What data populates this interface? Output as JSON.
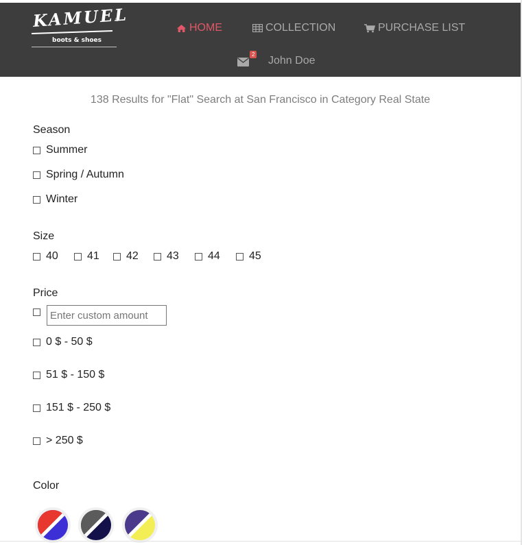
{
  "brand": {
    "name": "KAMUEL",
    "tagline": "boots & shoes",
    "reg": "®"
  },
  "nav": {
    "home": "HOME",
    "collection": "COLLECTION",
    "purchase_list": "PURCHASE LIST",
    "mail_count": "2",
    "user": "John Doe",
    "active": "home",
    "icons": {
      "home": "home-icon",
      "collection": "table-icon",
      "purchase": "cart-icon",
      "mail": "envelope-icon"
    }
  },
  "results_text": "138 Results for \"Flat\" Search at San Francisco in Category Real State",
  "filters": {
    "season": {
      "title": "Season",
      "options": [
        "Summer",
        "Spring / Autumn",
        "Winter"
      ]
    },
    "size": {
      "title": "Size",
      "options": [
        "40",
        "41",
        "42",
        "43",
        "44",
        "45"
      ]
    },
    "price": {
      "title": "Price",
      "custom_placeholder": "Enter custom amount",
      "custom_value": "",
      "options": [
        "0 $ - 50 $",
        "51 $ - 150 $",
        "151 $ - 250 $",
        "> 250 $"
      ]
    },
    "color": {
      "title": "Color",
      "swatches": [
        {
          "name": "red-blue",
          "c1": "#e8372f",
          "c2": "#3d2fd6"
        },
        {
          "name": "gray-navy",
          "c1": "#5b5b5b",
          "c2": "#14104a"
        },
        {
          "name": "purple-yellow",
          "c1": "#4b3a8c",
          "c2": "#f3ee55"
        }
      ]
    }
  },
  "colors": {
    "navbar_bg": "#3d3d3d",
    "active_link": "#e05768",
    "nav_link": "#a9a9a9",
    "badge": "#d9534f"
  }
}
